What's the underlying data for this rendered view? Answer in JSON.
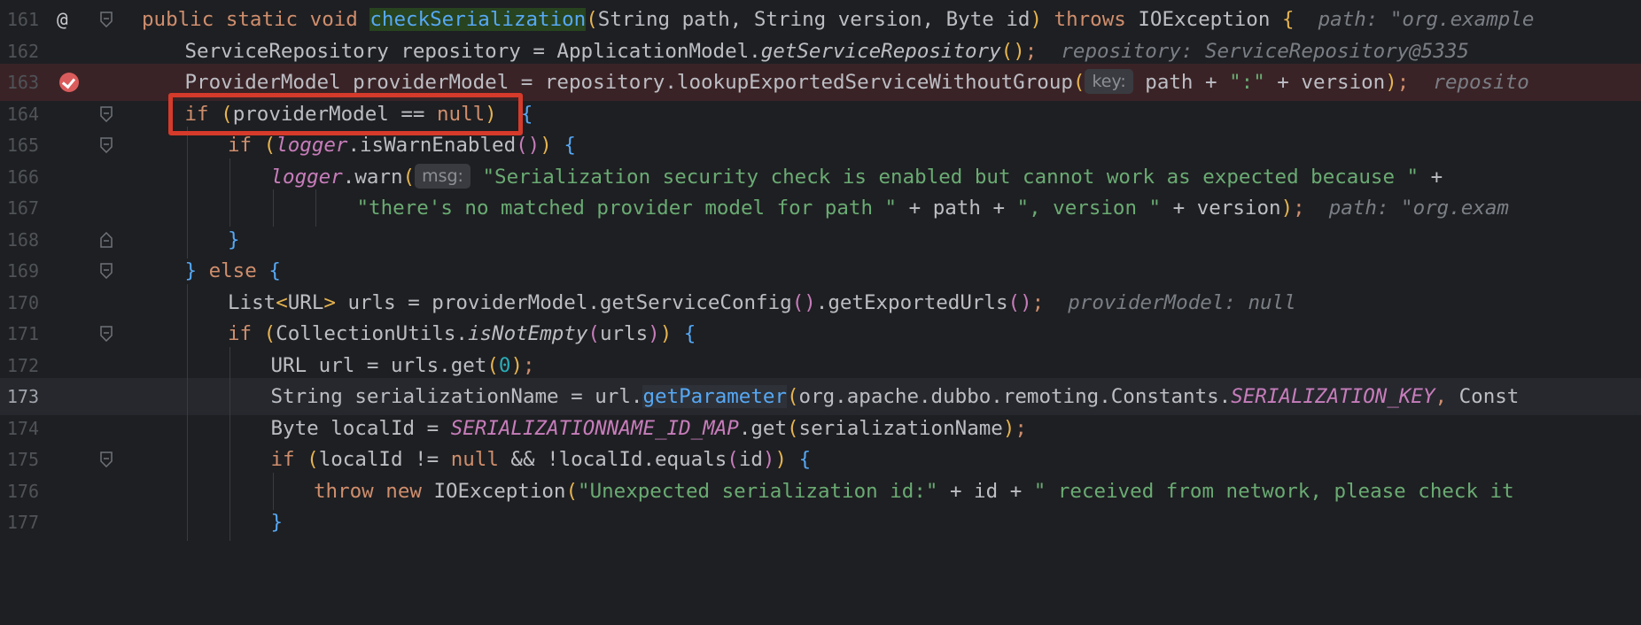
{
  "lines": [
    {
      "n": "161",
      "bp": false,
      "at": true,
      "fold": "open",
      "indent": 0,
      "tokens": [
        [
          "kw",
          "public static void "
        ],
        [
          "fnhl",
          "checkSerialization"
        ],
        [
          "brk",
          "("
        ],
        [
          "",
          "String path, String version, Byte id"
        ],
        [
          "brk",
          ")"
        ],
        [
          "kw",
          " throws "
        ],
        [
          "",
          "IOException "
        ],
        [
          "brk",
          "{"
        ],
        [
          "sp",
          "  "
        ],
        [
          "hint",
          "path: \"org.example"
        ]
      ]
    },
    {
      "n": "162",
      "indent": 1,
      "tokens": [
        [
          "",
          "ServiceRepository repository = ApplicationModel."
        ],
        [
          "ital-call",
          "getServiceRepository"
        ],
        [
          "brk",
          "()"
        ],
        [
          "kw",
          ";"
        ],
        [
          "sp",
          "  "
        ],
        [
          "hint",
          "repository: ServiceRepository@5335"
        ]
      ]
    },
    {
      "n": "163",
      "bp": true,
      "indent": 1,
      "tokens": [
        [
          "",
          "ProviderModel providerModel = repository.lookupExportedServiceWithoutGroup"
        ],
        [
          "brk",
          "("
        ],
        [
          "hint-box",
          "key:"
        ],
        [
          "",
          "path + "
        ],
        [
          "str",
          "\":\""
        ],
        [
          "",
          " + version"
        ],
        [
          "brk",
          ")"
        ],
        [
          "kw",
          ";"
        ],
        [
          "sp",
          "  "
        ],
        [
          "hint",
          "reposito"
        ]
      ]
    },
    {
      "n": "164",
      "fold": "open",
      "indent": 1,
      "tokens": [
        [
          "kw",
          "if "
        ],
        [
          "brk",
          "("
        ],
        [
          "",
          "providerModel == "
        ],
        [
          "kw",
          "null"
        ],
        [
          "brk",
          ")"
        ],
        [
          "",
          "  "
        ],
        [
          "brk3",
          "{"
        ]
      ]
    },
    {
      "n": "165",
      "fold": "open",
      "indent": 2,
      "tokens": [
        [
          "kw",
          "if "
        ],
        [
          "brk",
          "("
        ],
        [
          "purple",
          "logger"
        ],
        [
          "",
          ".isWarnEnabled"
        ],
        [
          "brk2",
          "()"
        ],
        [
          "brk",
          ")"
        ],
        [
          "",
          " "
        ],
        [
          "brk3",
          "{"
        ]
      ]
    },
    {
      "n": "166",
      "indent": 3,
      "tokens": [
        [
          "purple",
          "logger"
        ],
        [
          "",
          ".warn"
        ],
        [
          "brk",
          "("
        ],
        [
          "hint-box",
          "msg:"
        ],
        [
          "str",
          "\"Serialization security check is enabled but cannot work as expected because \""
        ],
        [
          "",
          " +"
        ]
      ]
    },
    {
      "n": "167",
      "indent": 5,
      "tokens": [
        [
          "str",
          "\"there's no matched provider model for path \""
        ],
        [
          "",
          " + path + "
        ],
        [
          "str",
          "\", version \""
        ],
        [
          "",
          " + version"
        ],
        [
          "brk",
          ")"
        ],
        [
          "kw",
          ";"
        ],
        [
          "sp",
          "  "
        ],
        [
          "hint",
          "path: \"org.exam"
        ]
      ]
    },
    {
      "n": "168",
      "fold": "close",
      "indent": 2,
      "tokens": [
        [
          "brk3",
          "}"
        ]
      ]
    },
    {
      "n": "169",
      "fold": "open",
      "indent": 1,
      "tokens": [
        [
          "brk3",
          "}"
        ],
        [
          "kw",
          " else "
        ],
        [
          "brk3",
          "{"
        ]
      ]
    },
    {
      "n": "170",
      "indent": 2,
      "tokens": [
        [
          "",
          "List"
        ],
        [
          "brk",
          "<"
        ],
        [
          "",
          "URL"
        ],
        [
          "brk",
          ">"
        ],
        [
          "",
          " urls = providerModel.getServiceConfig"
        ],
        [
          "brk2",
          "()"
        ],
        [
          "",
          ".getExportedUrls"
        ],
        [
          "brk2",
          "()"
        ],
        [
          "kw",
          ";"
        ],
        [
          "sp",
          "  "
        ],
        [
          "hint",
          "providerModel: null"
        ]
      ]
    },
    {
      "n": "171",
      "fold": "open",
      "indent": 2,
      "tokens": [
        [
          "kw",
          "if "
        ],
        [
          "brk",
          "("
        ],
        [
          "",
          "CollectionUtils."
        ],
        [
          "ital-call",
          "isNotEmpty"
        ],
        [
          "brk2",
          "("
        ],
        [
          "",
          "urls"
        ],
        [
          "brk2",
          ")"
        ],
        [
          "brk",
          ")"
        ],
        [
          "",
          " "
        ],
        [
          "brk3",
          "{"
        ]
      ]
    },
    {
      "n": "172",
      "indent": 3,
      "tokens": [
        [
          "",
          "URL url = urls.get"
        ],
        [
          "brk",
          "("
        ],
        [
          "num",
          "0"
        ],
        [
          "brk",
          ")"
        ],
        [
          "kw",
          ";"
        ]
      ]
    },
    {
      "n": "173",
      "current": true,
      "indent": 3,
      "tokens": [
        [
          "",
          "String serializationName = url."
        ],
        [
          "caret-hl-fn",
          "getParameter"
        ],
        [
          "brk",
          "("
        ],
        [
          "",
          "org.apache.dubbo.remoting.Constants."
        ],
        [
          "purple",
          "SERIALIZATION_KEY"
        ],
        [
          "kw",
          ", "
        ],
        [
          "",
          "Const"
        ]
      ]
    },
    {
      "n": "174",
      "indent": 3,
      "tokens": [
        [
          "",
          "Byte localId = "
        ],
        [
          "purple",
          "SERIALIZATIONNAME_ID_MAP"
        ],
        [
          "",
          ".get"
        ],
        [
          "brk",
          "("
        ],
        [
          "",
          "serializationName"
        ],
        [
          "brk",
          ")"
        ],
        [
          "kw",
          ";"
        ]
      ]
    },
    {
      "n": "175",
      "fold": "open",
      "indent": 3,
      "tokens": [
        [
          "kw",
          "if "
        ],
        [
          "brk",
          "("
        ],
        [
          "",
          "localId != "
        ],
        [
          "kw",
          "null"
        ],
        [
          "",
          " && !localId.equals"
        ],
        [
          "brk2",
          "("
        ],
        [
          "",
          "id"
        ],
        [
          "brk2",
          ")"
        ],
        [
          "brk",
          ")"
        ],
        [
          "",
          " "
        ],
        [
          "brk3",
          "{"
        ]
      ]
    },
    {
      "n": "176",
      "indent": 4,
      "tokens": [
        [
          "kw",
          "throw new "
        ],
        [
          "",
          "IOException"
        ],
        [
          "brk",
          "("
        ],
        [
          "str",
          "\"Unexpected serialization id:\""
        ],
        [
          "",
          " + id + "
        ],
        [
          "str",
          "\" received from network, please check it"
        ]
      ]
    },
    {
      "n": "177",
      "indent": 3,
      "tokens": [
        [
          "brk3",
          "}"
        ]
      ]
    }
  ],
  "highlight_box_color": "#d63a2a"
}
